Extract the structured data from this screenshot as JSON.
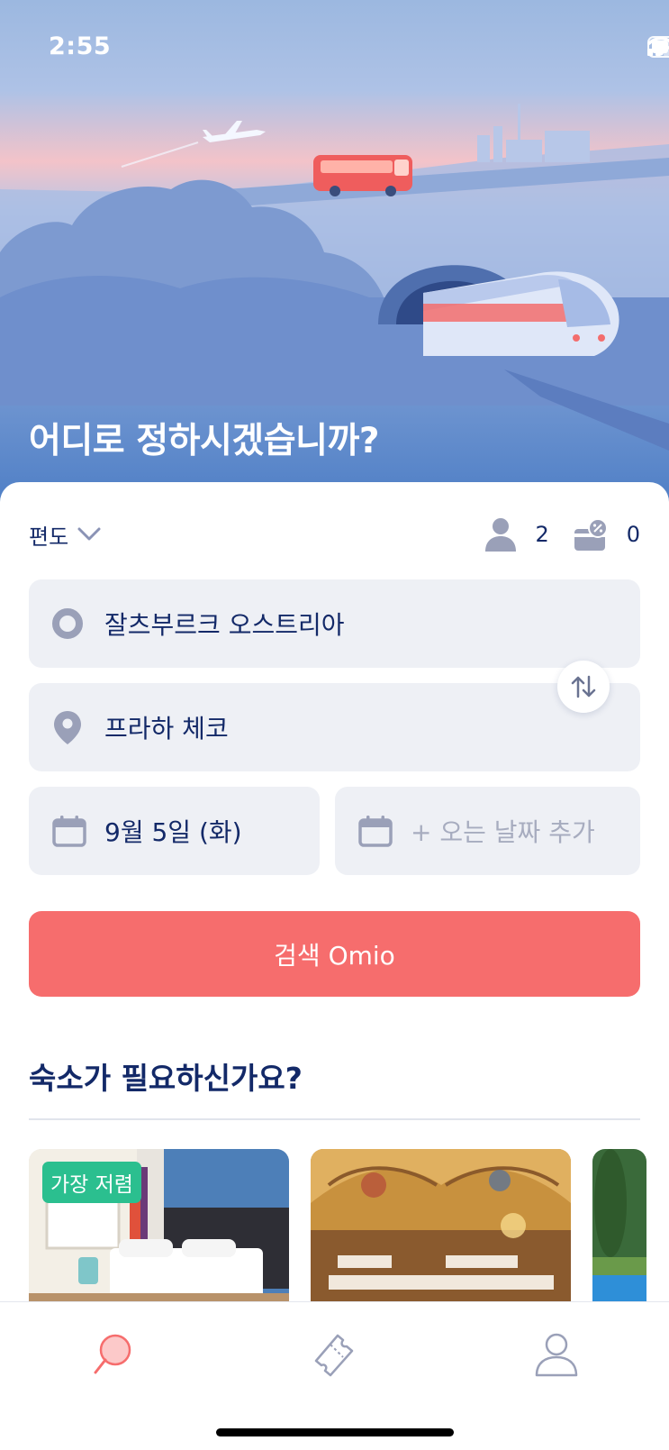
{
  "status_bar": {
    "time": "2:55"
  },
  "hero": {
    "title": "어디로 정하시겠습니까?"
  },
  "trip_options": {
    "trip_type": "편도",
    "passengers": "2",
    "discount_cards": "0"
  },
  "search_form": {
    "origin": "잘츠부르크 오스트리아",
    "destination": "프라하 체코",
    "depart_date": "9월 5일 (화)",
    "return_date_placeholder": "+ 오는 날짜 추가",
    "search_label": "검색  Omio"
  },
  "accommodation": {
    "title": "숙소가 필요하신가요?",
    "cards": [
      {
        "badge": "가장 저렴"
      }
    ]
  },
  "colors": {
    "primary": "#132968",
    "accent": "#f66d6d",
    "badge": "#2bbf8f",
    "field_bg": "#eef0f5",
    "icon_gray": "#9aa0b8"
  },
  "icons": {
    "trip_type": "chevron-down-icon",
    "passengers": "person-icon",
    "discount": "discount-card-icon",
    "origin": "circle-pin-icon",
    "destination": "map-pin-icon",
    "swap": "swap-icon",
    "calendar": "calendar-icon",
    "tab_search": "search-balloon-icon",
    "tab_tickets": "ticket-icon",
    "tab_account": "person-outline-icon"
  }
}
